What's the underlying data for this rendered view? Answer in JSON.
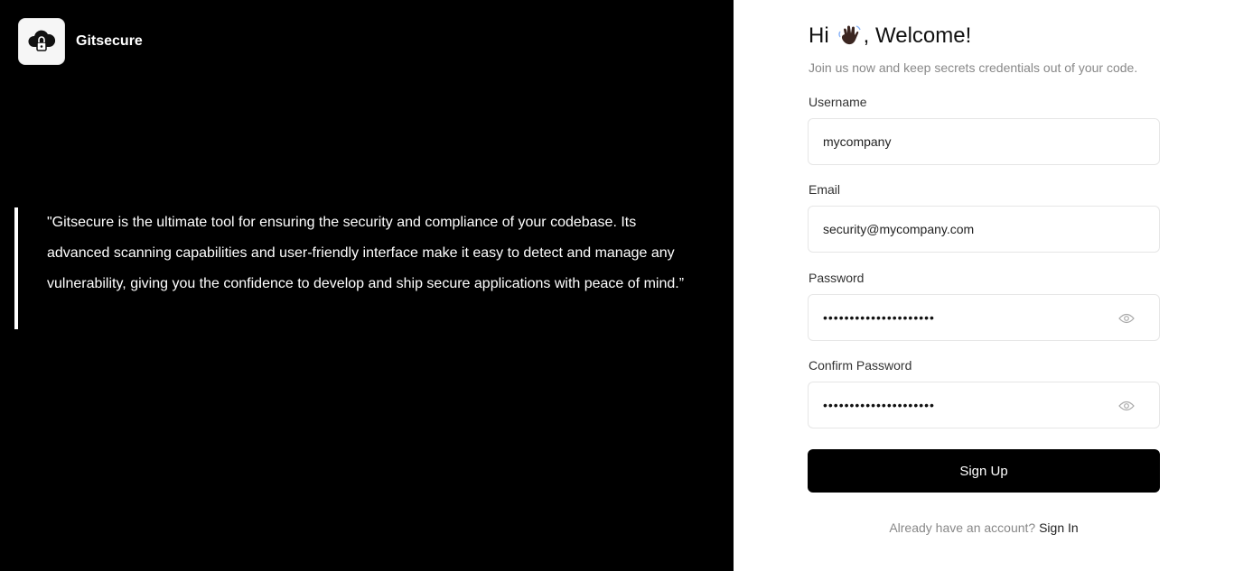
{
  "app": {
    "name": "Gitsecure",
    "logo_icon": "cloud-lock-icon"
  },
  "quote": {
    "text": "\"Gitsecure is the ultimate tool for ensuring the security and compliance of your codebase. Its advanced scanning capabilities and user-friendly interface make it easy to detect and manage any vulnerability, giving you the confidence to develop and ship secure applications with peace of mind.”"
  },
  "form": {
    "greeting_hi": "Hi",
    "greeting_rest": ", Welcome!",
    "greeting_icon": "waving-hand-icon",
    "subtitle": "Join us now and keep secrets credentials out of your code.",
    "username": {
      "label": "Username",
      "value": "mycompany"
    },
    "email": {
      "label": "Email",
      "value": "security@mycompany.com"
    },
    "password": {
      "label": "Password",
      "masked_value": "•••••••••••••••••••••"
    },
    "confirm_password": {
      "label": "Confirm Password",
      "masked_value": "•••••••••••••••••••••"
    },
    "submit_label": "Sign Up",
    "footer_text": "Already have an account?",
    "footer_link": "Sign In"
  },
  "colors": {
    "left_bg": "#000000",
    "button_bg": "#000000",
    "muted_text": "#888888"
  }
}
